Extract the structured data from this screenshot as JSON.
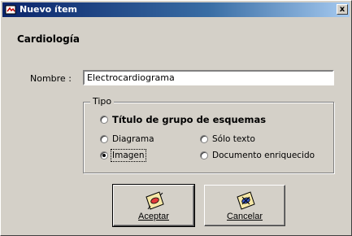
{
  "window": {
    "title": "Nuevo ítem"
  },
  "header": {
    "title": "Cardiología"
  },
  "form": {
    "name_label": "Nombre :",
    "name_value": "Electrocardiograma",
    "type_group_label": "Tipo",
    "options": [
      {
        "label": "Título de grupo de esquemas",
        "checked": false
      },
      {
        "label": "Diagrama",
        "checked": false
      },
      {
        "label": "Sólo texto",
        "checked": false
      },
      {
        "label": "Imagen",
        "checked": true
      },
      {
        "label": "Documento enriquecido",
        "checked": false
      }
    ]
  },
  "buttons": {
    "accept_label": "Aceptar",
    "cancel_label": "Cancelar"
  },
  "colors": {
    "titlebar_start": "#0a246a",
    "titlebar_end": "#a6caf0",
    "dialog_bg": "#d4d0c8"
  }
}
